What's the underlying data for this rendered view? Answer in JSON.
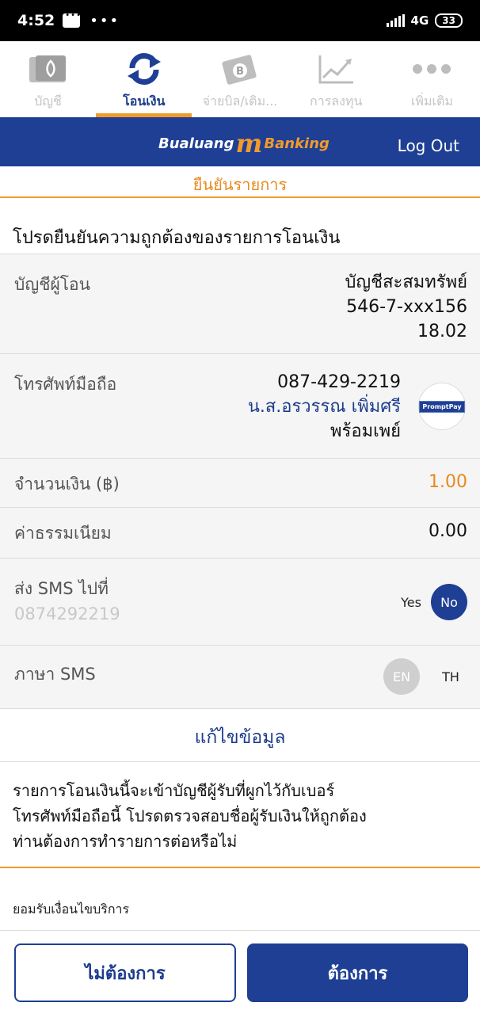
{
  "status_bar": {
    "time": "4:52",
    "dots": "•••",
    "network": "4G",
    "battery": "33"
  },
  "nav": {
    "items": [
      {
        "label": "บัญชี",
        "icon": "account-book-icon"
      },
      {
        "label": "โอนเงิน",
        "icon": "transfer-refresh-icon",
        "active": true
      },
      {
        "label": "จ่ายบิล/เติม...",
        "icon": "bill-payment-icon"
      },
      {
        "label": "การลงทุน",
        "icon": "investment-chart-icon"
      },
      {
        "label": "เพิ่มเติม",
        "icon": "more-dots-icon"
      }
    ]
  },
  "header": {
    "logo_left": "Bualuang",
    "logo_mark": "m",
    "logo_right": "Banking",
    "logout": "Log Out"
  },
  "sub_header": "ยืนยันรายการ",
  "prompt": "โปรดยืนยันความถูกต้องของรายการโอนเงิน",
  "rows": {
    "from_account": {
      "label": "บัญชีผู้โอน",
      "line1": "บัญชีสะสมทรัพย์",
      "line2": "546-7-xxx156",
      "line3": "18.02"
    },
    "mobile": {
      "label": "โทรศัพท์มือถือ",
      "line1": "087-429-2219",
      "line2": "น.ส.อรวรรณ เพิ่มศรี",
      "line3": "พร้อมเพย์",
      "logo_text": "PromptPay"
    },
    "amount": {
      "label": "จำนวนเงิน (฿)",
      "value": "1.00"
    },
    "fee": {
      "label": "ค่าธรรมเนียม",
      "value": "0.00"
    },
    "sms": {
      "label": "ส่ง SMS ไปที่",
      "number": "0874292219",
      "yes": "Yes",
      "no": "No"
    },
    "sms_lang": {
      "label": "ภาษา SMS",
      "en": "EN",
      "th": "TH"
    }
  },
  "edit": "แก้ไขข้อมูล",
  "notice": {
    "line1": "รายการโอนเงินนี้จะเข้าบัญชีผู้รับที่ผูกไว้กับเบอร์",
    "line2": "โทรศัพท์มือถือนี้ โปรดตรวจสอบชื่อผู้รับเงินให้ถูกต้อง",
    "line3": "ท่านต้องการทำรายการต่อหรือไม่"
  },
  "terms": "ยอมรับเงื่อนไขบริการ",
  "buttons": {
    "cancel": "ไม่ต้องการ",
    "confirm": "ต้องการ"
  },
  "colors": {
    "brand_blue": "#1e3f94",
    "accent_orange": "#f29a2a"
  }
}
